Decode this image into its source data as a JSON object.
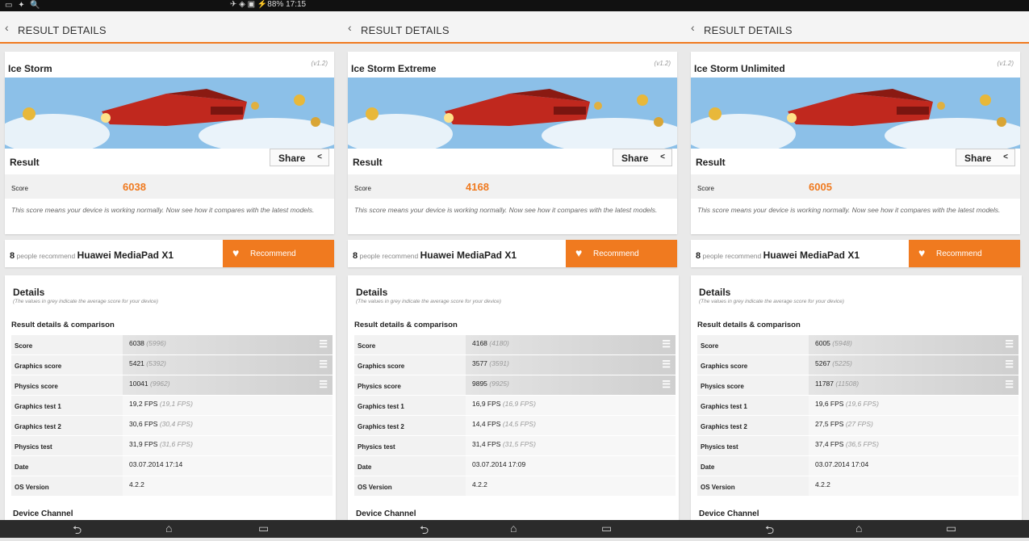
{
  "status_bar": {
    "left_icons": "▭ ✦ 🔍",
    "center_text": "✈ ◈ ▣ ⚡88% 17:15"
  },
  "colors": {
    "accent": "#f07a1f",
    "background": "#e9e9e9"
  },
  "panels": [
    {
      "header": "RESULT DETAILS",
      "test_name": "Ice Storm",
      "version": "(v1.2)",
      "result_label": "Result",
      "share_label": "Share",
      "score_label": "Score",
      "score": "6038",
      "note": "This score means your device is working normally. Now see how it compares with the latest models.",
      "rec_count": "8",
      "rec_text": "people recommend",
      "device": "Huawei MediaPad X1",
      "recommend_label": "Recommend",
      "details_title": "Details",
      "details_sub": "(The values in grey indicate the average score for your device)",
      "comparison_title": "Result details & comparison",
      "rows": [
        {
          "k": "Score",
          "v": "6038",
          "avg": "(5996)"
        },
        {
          "k": "Graphics score",
          "v": "5421",
          "avg": "(5392)"
        },
        {
          "k": "Physics score",
          "v": "10041",
          "avg": "(9962)"
        },
        {
          "k": "Graphics test 1",
          "v": "19,2 FPS",
          "avg": "(19,1 FPS)"
        },
        {
          "k": "Graphics test 2",
          "v": "30,6 FPS",
          "avg": "(30,4 FPS)"
        },
        {
          "k": "Physics test",
          "v": "31,9 FPS",
          "avg": "(31,6 FPS)"
        },
        {
          "k": "Date",
          "v": "03.07.2014 17:14",
          "avg": ""
        },
        {
          "k": "OS Version",
          "v": "4.2.2",
          "avg": ""
        }
      ],
      "device_channel": "Device Channel"
    },
    {
      "header": "RESULT DETAILS",
      "test_name": "Ice Storm Extreme",
      "version": "(v1.2)",
      "result_label": "Result",
      "share_label": "Share",
      "score_label": "Score",
      "score": "4168",
      "note": "This score means your device is working normally. Now see how it compares with the latest models.",
      "rec_count": "8",
      "rec_text": "people recommend",
      "device": "Huawei MediaPad X1",
      "recommend_label": "Recommend",
      "details_title": "Details",
      "details_sub": "(The values in grey indicate the average score for your device)",
      "comparison_title": "Result details & comparison",
      "rows": [
        {
          "k": "Score",
          "v": "4168",
          "avg": "(4180)"
        },
        {
          "k": "Graphics score",
          "v": "3577",
          "avg": "(3591)"
        },
        {
          "k": "Physics score",
          "v": "9895",
          "avg": "(9925)"
        },
        {
          "k": "Graphics test 1",
          "v": "16,9 FPS",
          "avg": "(16,9 FPS)"
        },
        {
          "k": "Graphics test 2",
          "v": "14,4 FPS",
          "avg": "(14,5 FPS)"
        },
        {
          "k": "Physics test",
          "v": "31,4 FPS",
          "avg": "(31,5 FPS)"
        },
        {
          "k": "Date",
          "v": "03.07.2014 17:09",
          "avg": ""
        },
        {
          "k": "OS Version",
          "v": "4.2.2",
          "avg": ""
        }
      ],
      "device_channel": "Device Channel"
    },
    {
      "header": "RESULT DETAILS",
      "test_name": "Ice Storm Unlimited",
      "version": "(v1.2)",
      "result_label": "Result",
      "share_label": "Share",
      "score_label": "Score",
      "score": "6005",
      "note": "This score means your device is working normally. Now see how it compares with the latest models.",
      "rec_count": "8",
      "rec_text": "people recommend",
      "device": "Huawei MediaPad X1",
      "recommend_label": "Recommend",
      "details_title": "Details",
      "details_sub": "(The values in grey indicate the average score for your device)",
      "comparison_title": "Result details & comparison",
      "rows": [
        {
          "k": "Score",
          "v": "6005",
          "avg": "(5948)"
        },
        {
          "k": "Graphics score",
          "v": "5267",
          "avg": "(5225)"
        },
        {
          "k": "Physics score",
          "v": "11787",
          "avg": "(11508)"
        },
        {
          "k": "Graphics test 1",
          "v": "19,6 FPS",
          "avg": "(19,6 FPS)"
        },
        {
          "k": "Graphics test 2",
          "v": "27,5 FPS",
          "avg": "(27 FPS)"
        },
        {
          "k": "Physics test",
          "v": "37,4 FPS",
          "avg": "(36,5 FPS)"
        },
        {
          "k": "Date",
          "v": "03.07.2014 17:04",
          "avg": ""
        },
        {
          "k": "OS Version",
          "v": "4.2.2",
          "avg": ""
        }
      ],
      "device_channel": "Device Channel"
    }
  ],
  "nav": {
    "back": "⮌",
    "home": "⌂",
    "recents": "▭"
  }
}
